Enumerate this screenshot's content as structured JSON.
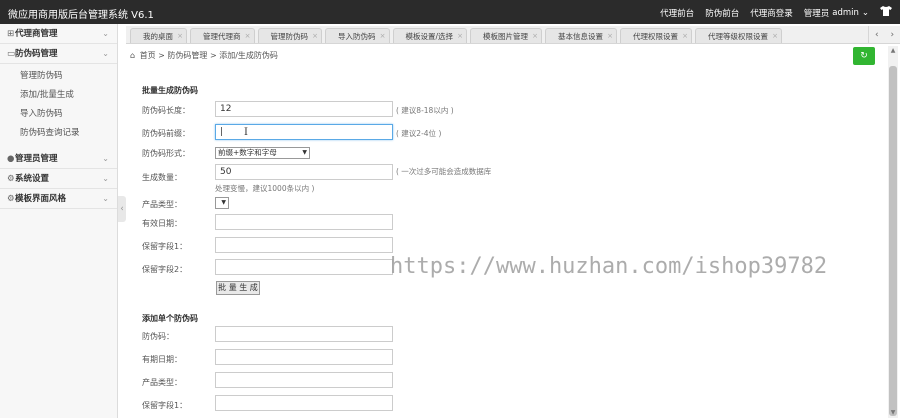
{
  "app": {
    "title": "微应用商用版后台管理系统 V6.1"
  },
  "topnav": {
    "items": [
      "代理前台",
      "防伪前台",
      "代理商登录"
    ],
    "role": "管理员",
    "user": "admin",
    "user_chevron": "⌄",
    "shirt_icon": "shirt-icon"
  },
  "sidebar": {
    "groups": [
      {
        "label": "代理商管理",
        "icon": "⊞"
      },
      {
        "label": "防伪码管理",
        "icon": "▭"
      },
      {
        "label": "管理员管理",
        "icon": "●"
      },
      {
        "label": "系统设置",
        "icon": "⚙"
      },
      {
        "label": "模板界面风格",
        "icon": "⚙"
      }
    ],
    "sub_items": [
      "管理防伪码",
      "添加/批量生成",
      "导入防伪码",
      "防伪码查询记录"
    ],
    "collapse_icon": "‹"
  },
  "tabs": [
    {
      "label": "我的桌面"
    },
    {
      "label": "管理代理商"
    },
    {
      "label": "管理防伪码"
    },
    {
      "label": "导入防伪码"
    },
    {
      "label": "模板设置/选择"
    },
    {
      "label": "模板图片管理"
    },
    {
      "label": "基本信息设置"
    },
    {
      "label": "代理权限设置"
    },
    {
      "label": "代理等级权限设置"
    }
  ],
  "tab_nav": {
    "prev": "‹",
    "next": "›"
  },
  "breadcrumb": {
    "home_icon": "⌂",
    "home": "首页",
    "sep": ">",
    "level1": "防伪码管理",
    "level2": "添加/生成防伪码"
  },
  "refresh_icon": "↻",
  "batch": {
    "section_title": "批量生成防伪码",
    "length_label": "防伪码长度：",
    "length_value": "12",
    "length_hint": "( 建议8-18以内 )",
    "prefix_label": "防伪码前缀：",
    "prefix_value": "|",
    "prefix_hint": "( 建议2-4位 )",
    "form_label": "防伪码形式：",
    "form_value": "前缀+数字和字母",
    "qty_label": "生成数量：",
    "qty_value": "50",
    "qty_hint": "( 一次过多可能会造成数据库",
    "qty_hint2": "处理变慢，建议1000条以内 )",
    "type_label": "产品类型：",
    "expiry_label": "有效日期：",
    "field1_label": "保留字段1：",
    "field2_label": "保留字段2：",
    "gen_button": "批 量 生 成"
  },
  "single": {
    "section_title": "添加单个防伪码",
    "code_label": "防伪码：",
    "expiry_label": "有期日期：",
    "type_label": "产品类型：",
    "field1_label": "保留字段1："
  },
  "watermark": "https://www.huzhan.com/ishop39782"
}
